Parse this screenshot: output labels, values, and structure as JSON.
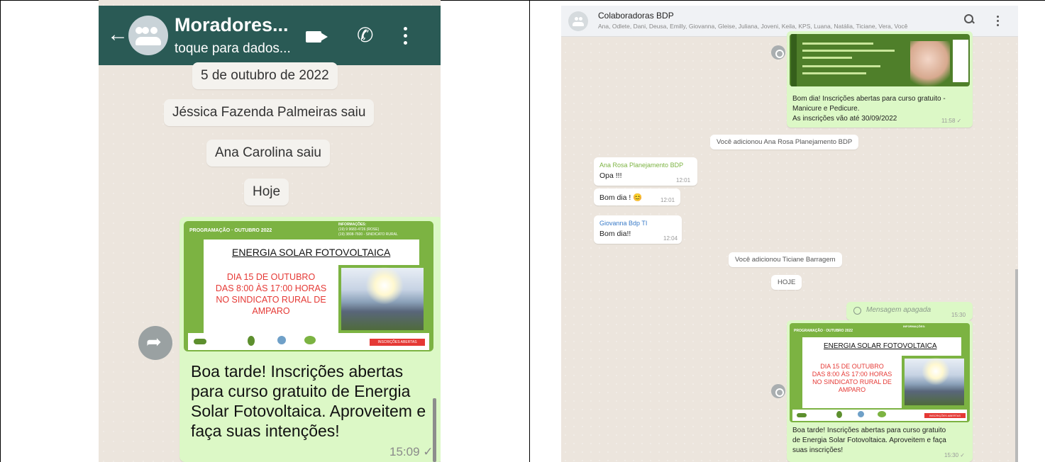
{
  "left": {
    "header": {
      "back_icon": "arrow-left-icon",
      "title": "Moradores...",
      "subtitle": "toque para dados...",
      "header_color": "#2a5a55"
    },
    "system_messages": [
      "5 de outubro de 2022",
      "Jéssica Fazenda Palmeiras saiu",
      "Ana Carolina saiu",
      "Hoje"
    ],
    "poster": {
      "programacao": "PROGRAMAÇÃO · OUTUBRO 2022",
      "info_title": "INFORMAÇÕES:",
      "info_line1": "(19) 9 9683-4726 (ROSE)",
      "info_line2": "(19) 3808-7600 - SINDICATO RURAL",
      "title": "ENERGIA SOLAR FOTOVOLTAICA",
      "line1": "DIA 15 DE OUTUBRO",
      "line2": "DAS 8:00 ÀS 17:00 HORAS",
      "line3": "NO SINDICATO RURAL DE",
      "line4": "AMPARO",
      "badge": "INSCRIÇÕES ABERTAS"
    },
    "caption": "Boa tarde! Inscrições abertas para curso gratuito de Energia Solar Fotovoltaica. Aproveitem e faça suas intenções!",
    "time": "15:09 ✓"
  },
  "right": {
    "header": {
      "title": "Colaboradoras BDP",
      "members": "Ana, Odlete, Dani, Deusa, Emilly, Giovanna, Gleise, Juliana, Joveni, Keila, KPS, Luana, Natália, Ticiane, Vera, Você"
    },
    "prev_message": {
      "caption_line1": "Bom dia! Inscrições abertas para curso gratuito -",
      "caption_line2": "Manicure e Pedicure.",
      "caption_line3": "As inscrições vão até 30/09/2022",
      "time": "11:58 ✓"
    },
    "system_added_1": "Você adicionou Ana Rosa Planejamento BDP",
    "msg_anarosa": {
      "sender": "Ana Rosa Planejamento BDP",
      "text": "Opa !!!",
      "time": "12:01"
    },
    "msg_bomdia": {
      "text": "Bom dia ! 😊",
      "time": "12:01"
    },
    "msg_giovanna": {
      "sender": "Giovanna Bdp TI",
      "text": "Bom dia!!",
      "time": "12:04"
    },
    "system_added_2": "Você adicionou Ticiane Barragem",
    "system_today": "HOJE",
    "deleted": {
      "text": "Mensagem apagada",
      "time": "15:30"
    },
    "poster": {
      "programacao": "PROGRAMAÇÃO · OUTUBRO 2022",
      "info_title": "INFORMAÇÕES:",
      "title": "ENERGIA SOLAR FOTOVOLTAICA",
      "line1": "DIA 15 DE OUTUBRO",
      "line2": "DAS 8:00 ÀS 17:00 HORAS",
      "line3": "NO SINDICATO RURAL DE",
      "line4": "AMPARO",
      "badge": "INSCRIÇÕES ABERTAS"
    },
    "caption_line1": "Boa tarde! Inscrições abertas para curso gratuito",
    "caption_line2": "de Energia Solar Fotovoltaica. Aproveitem e faça",
    "caption_line3": "suas inscrições!",
    "time": "15:30 ✓"
  }
}
